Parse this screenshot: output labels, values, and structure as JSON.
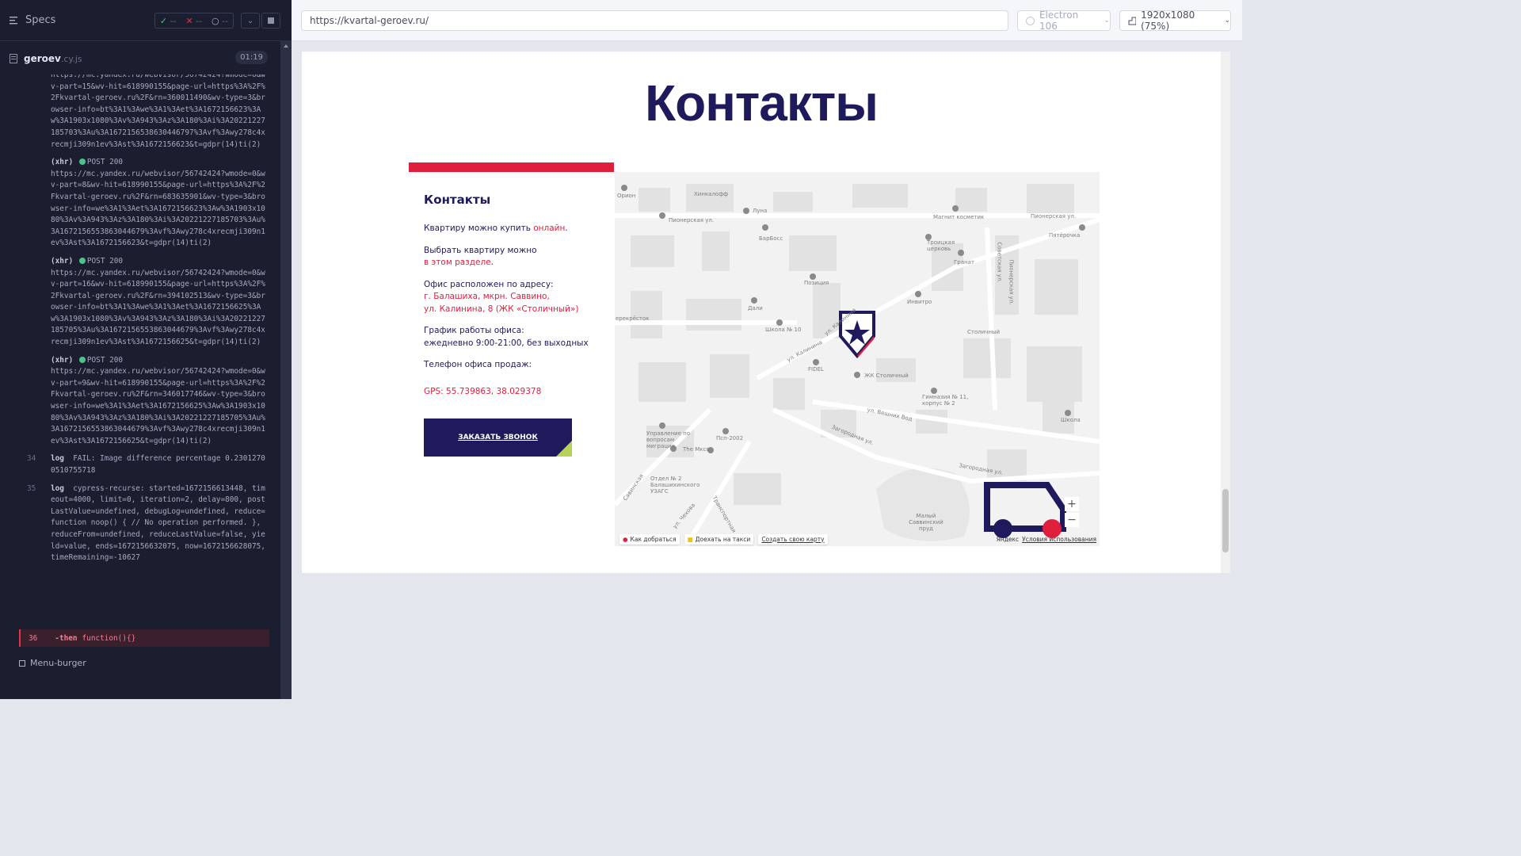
{
  "reporter": {
    "specs_label": "Specs",
    "counters": {
      "passed": "--",
      "failed": "--",
      "pending": "--"
    },
    "spec": {
      "name": "geroev",
      "ext": ".cy.js",
      "time": "01:19"
    },
    "log_entries": [
      {
        "type": "",
        "status": "",
        "text": "https://mc.yandex.ru/webvisor/56742424?wmode=0&wv-part=15&wv-hit=618990155&page-url=https%3A%2F%2Fkvartal-geroev.ru%2F&rn=360011490&wv-type=3&browser-info=bt%3A1%3Awe%3A1%3Aet%3A1672156623%3Aw%3A1903x1080%3Av%3A943%3Az%3A180%3Ai%3A20221227185703%3Au%3A1672156538630446797%3Avf%3Awy278c4xrecmji309n1ev%3Ast%3A1672156623&t=gdpr(14)ti(2)"
      },
      {
        "type": "(xhr)",
        "status": "POST 200",
        "text": "https://mc.yandex.ru/webvisor/56742424?wmode=0&wv-part=8&wv-hit=618990155&page-url=https%3A%2F%2Fkvartal-geroev.ru%2F&rn=683635901&wv-type=3&browser-info=we%3A1%3Aet%3A1672156623%3Aw%3A1903x1080%3Av%3A943%3Az%3A180%3Ai%3A20221227185703%3Au%3A1672156553863044679%3Avf%3Awy278c4xrecmji309n1ev%3Ast%3A1672156623&t=gdpr(14)ti(2)"
      },
      {
        "type": "(xhr)",
        "status": "POST 200",
        "text": "https://mc.yandex.ru/webvisor/56742424?wmode=0&wv-part=16&wv-hit=618990155&page-url=https%3A%2F%2Fkvartal-geroev.ru%2F&rn=394102513&wv-type=3&browser-info=bt%3A1%3Awe%3A1%3Aet%3A1672156625%3Aw%3A1903x1080%3Av%3A943%3Az%3A180%3Ai%3A20221227185705%3Au%3A1672156553863044679%3Avf%3Awy278c4xrecmji309n1ev%3Ast%3A1672156625&t=gdpr(14)ti(2)"
      },
      {
        "type": "(xhr)",
        "status": "POST 200",
        "text": "https://mc.yandex.ru/webvisor/56742424?wmode=0&wv-part=9&wv-hit=618990155&page-url=https%3A%2F%2Fkvartal-geroev.ru%2F&rn=346017746&wv-type=3&browser-info=we%3A1%3Aet%3A1672156625%3Aw%3A1903x1080%3Av%3A943%3Az%3A180%3Ai%3A20221227185705%3Au%3A1672156553863044679%3Avf%3Awy278c4xrecmji309n1ev%3Ast%3A1672156625&t=gdpr(14)ti(2)"
      }
    ],
    "log_34": {
      "num": "34",
      "label": "log",
      "text": "FAIL: Image difference percentage 0.23012700510755718"
    },
    "log_35": {
      "num": "35",
      "label": "log",
      "text": "cypress-recurse: started=1672156613448, timeout=4000, limit=0, iteration=2, delay=800, postLastValue=undefined, debugLog=undefined, reduce=function noop() { // No operation performed. }, reduceFrom=undefined, reduceLastValue=false, yield=value, ends=1672156632075, now=1672156628075, timeRemaining=-10627"
    },
    "fail_line": {
      "num": "36",
      "label": "-then",
      "text": "function(){}"
    },
    "menu_burger": "Menu-burger"
  },
  "browser": {
    "url": "https://kvartal-geroev.ru/",
    "engine": "Electron 106",
    "viewport": "1920x1080 (75%)"
  },
  "page": {
    "title": "Контакты",
    "card_title": "Контакты",
    "buy_text": "Квартиру можно купить ",
    "buy_link": "онлайн",
    "choose_text": "Выбрать квартиру можно",
    "choose_link": "в этом разделе",
    "office_text": "Офис расположен по адресу:",
    "office_addr1": "г. Балашиха, мкрн. Саввино,",
    "office_addr2": "ул. Калинина, 8 (ЖК «Столичный»)",
    "hours_label": "График работы офиса:",
    "hours_value": "ежедневно 9:00-21:00, без выходных",
    "phone_label": "Телефон офиса продаж:",
    "gps": "GPS: 55.739863, 38.029378",
    "cta": "ЗАКАЗАТЬ ЗВОНОК"
  },
  "map": {
    "labels": {
      "hinkal": "Хинкалофф",
      "orion": "Орион",
      "luna": "Луна",
      "magnit": "Магнит косметик",
      "pionerskaya1": "Пионерская ул.",
      "pionerskaya2": "Пионерская ул.",
      "pyaterochka": "Пятёрочка",
      "barboss": "БарБосс",
      "church": "Троицкая церковь",
      "granat": "Гранат",
      "poziciya": "Позиция",
      "invitro": "Инвитро",
      "dali": "Дали",
      "school10": "Школа № 10",
      "crossroads": "ерекрёсток",
      "fidel": "FIDEL",
      "stolichny_label": "Столичный",
      "stolichny": "ЖК Столичный",
      "kalinina": "ул. Калинина",
      "kalinina2": "ул. Калинина",
      "gymnasium": "Гимназия № 11, корпус № 2",
      "school": "Школа",
      "migration": "Управление по вопросам миграции",
      "psp": "Псп-2002",
      "mkso": "The Мксо",
      "veshnyh": "ул. Вешних Вод",
      "zagorodnaya": "Загородная ул.",
      "zagorodnaya2": "Загородная ул.",
      "zags": "Отдел № 2 Балашихинского УЗАГС",
      "chehova": "ул. Чехова",
      "transport": "Транспортная",
      "pond": "Малый Саввинский пруд",
      "savvinsky_ch": "Савинская",
      "sovetskaya": "Советская ул.",
      "pionerskaya3": "Пионерская ул."
    },
    "how_to_get": "Как добраться",
    "taxi": "Доехать на такси",
    "create_map": "Создать свою карту",
    "yandex": "Яндекс",
    "terms": "Условия использования",
    "zoom_in": "+",
    "zoom_out": "−"
  },
  "colors": {
    "brand_navy": "#1e1a5c",
    "brand_red": "#e01f3d",
    "brand_green": "#b6d25a"
  }
}
